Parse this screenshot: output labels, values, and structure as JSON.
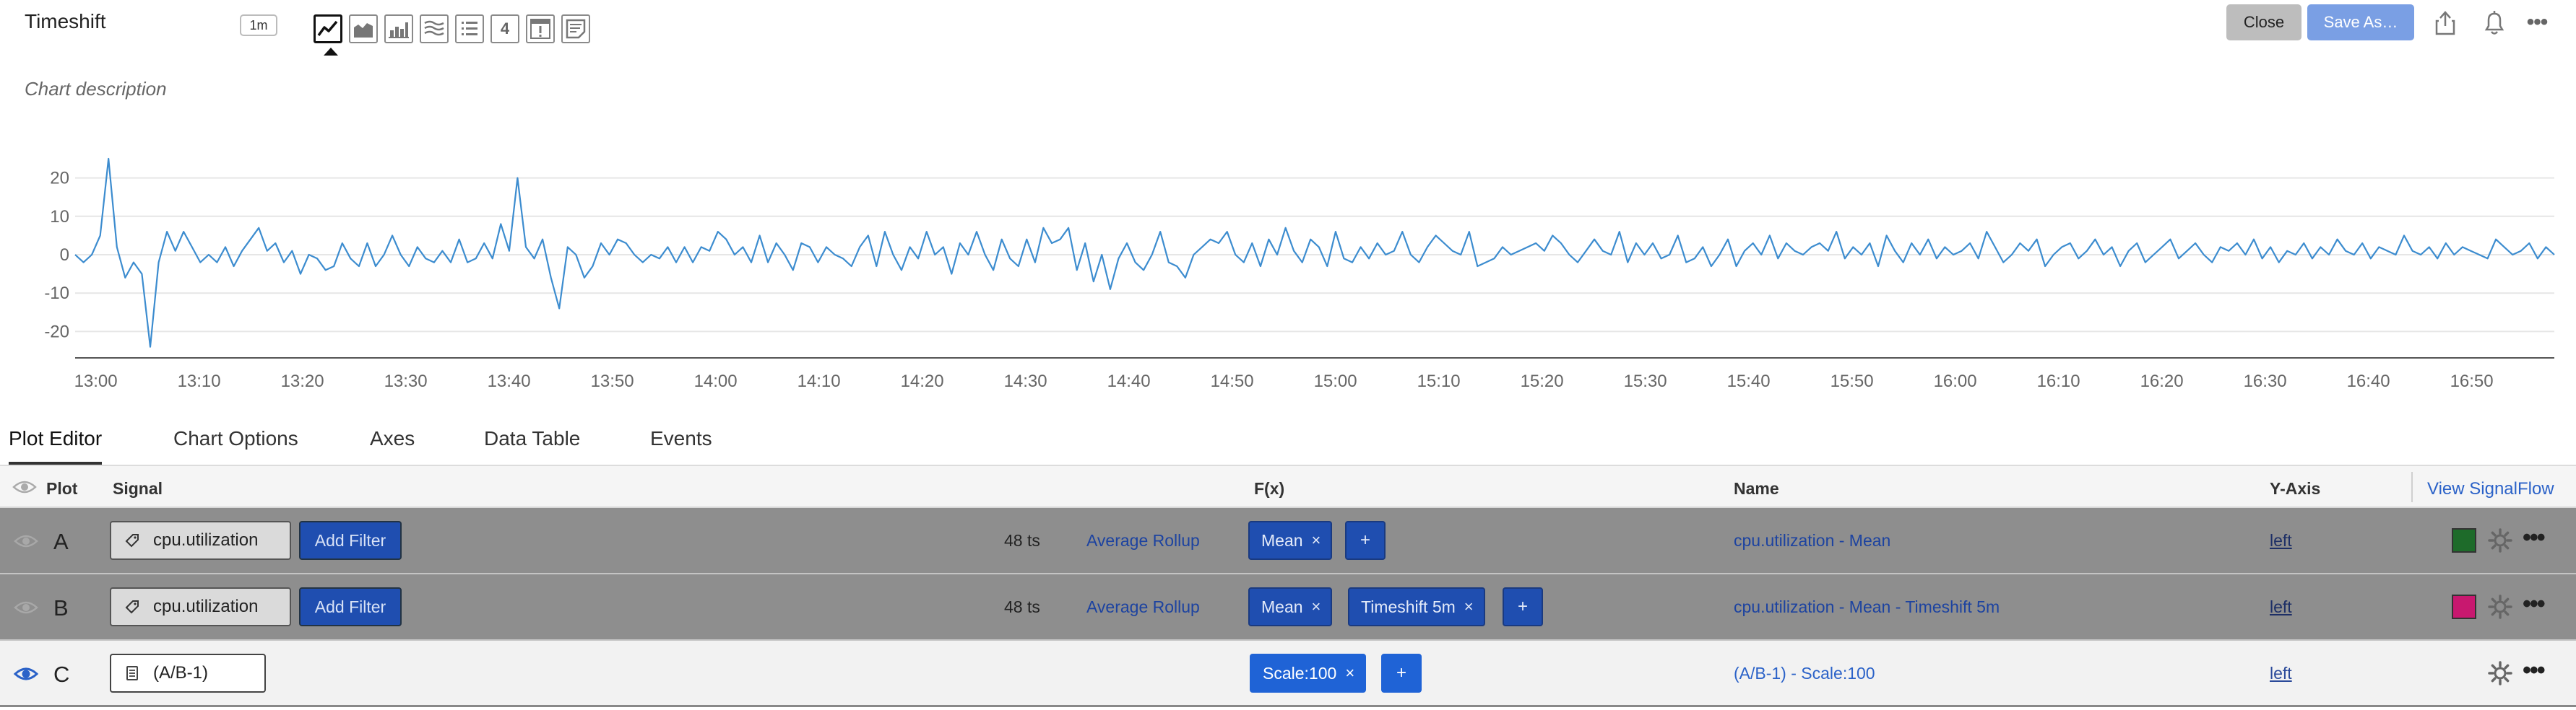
{
  "header": {
    "title": "Timeshift",
    "resolution": "1m",
    "chart_types": [
      {
        "icon": "line-chart-icon",
        "active": true
      },
      {
        "icon": "area-chart-icon",
        "active": false
      },
      {
        "icon": "column-chart-icon",
        "active": false
      },
      {
        "icon": "histogram-icon",
        "active": false
      },
      {
        "icon": "list-chart-icon",
        "active": false
      },
      {
        "icon": "single-value-icon",
        "label": "4",
        "active": false
      },
      {
        "icon": "event-feed-icon",
        "active": false
      },
      {
        "icon": "text-note-icon",
        "active": false
      }
    ],
    "description": "Chart description",
    "close_label": "Close",
    "save_label": "Save As…",
    "colors": {
      "save": "#7a9fe4",
      "close": "#bdbdbd"
    }
  },
  "chart_data": {
    "type": "line",
    "title": "",
    "xlabel": "",
    "ylabel": "",
    "ylim": [
      -25,
      25
    ],
    "y_ticks": [
      20,
      10,
      0,
      -10,
      -20
    ],
    "x_ticks": [
      "13:00",
      "13:10",
      "13:20",
      "13:30",
      "13:40",
      "13:50",
      "14:00",
      "14:10",
      "14:20",
      "14:30",
      "14:40",
      "14:50",
      "15:00",
      "15:10",
      "15:20",
      "15:30",
      "15:40",
      "15:50",
      "16:00",
      "16:10",
      "16:20",
      "16:30",
      "16:40",
      "16:50"
    ],
    "x_start": "12:58",
    "x_end": "16:58",
    "line_color": "#3c8ccf",
    "grid": true,
    "series": [
      {
        "values": [
          0,
          -2,
          0,
          5,
          25,
          2,
          -6,
          -2,
          -5,
          -24,
          -2,
          6,
          1,
          6,
          2,
          -2,
          0,
          -2,
          2,
          -3,
          1,
          4,
          7,
          1,
          3,
          -2,
          1,
          -5,
          0,
          -1,
          -4,
          -3,
          3,
          -1,
          -3,
          3,
          -3,
          0,
          5,
          0,
          -3,
          2,
          -1,
          -2,
          1,
          -2,
          4,
          -2,
          -1,
          3,
          -1,
          8,
          1,
          20,
          2,
          -1,
          4,
          -6,
          -14,
          2,
          0,
          -6,
          -3,
          3,
          0,
          4,
          3,
          0,
          -2,
          0,
          -1,
          2,
          -2,
          2,
          -2,
          2,
          1,
          6,
          4,
          0,
          2,
          -2,
          5,
          -2,
          3,
          0,
          -4,
          3,
          2,
          -2,
          2,
          0,
          -1,
          -3,
          2,
          5,
          -3,
          6,
          0,
          -4,
          2,
          -1,
          6,
          0,
          2,
          -5,
          3,
          0,
          6,
          0,
          -4,
          4,
          -1,
          -3,
          4,
          -2,
          7,
          3,
          4,
          7,
          -4,
          3,
          -7,
          0,
          -9,
          -1,
          3,
          -2,
          -4,
          0,
          6,
          -2,
          -3,
          -6,
          0,
          2,
          4,
          3,
          6,
          0,
          -2,
          3,
          -3,
          4,
          0,
          7,
          1,
          -2,
          4,
          2,
          -3,
          6,
          -1,
          -2,
          2,
          -1,
          3,
          0,
          1,
          6,
          0,
          -2,
          2,
          5,
          3,
          1,
          0,
          6,
          -3,
          -2,
          -1,
          2,
          0,
          1,
          2,
          3,
          1,
          5,
          3,
          0,
          -2,
          1,
          4,
          1,
          0,
          6,
          -2,
          3,
          0,
          3,
          -1,
          0,
          5,
          -2,
          -1,
          2,
          -3,
          0,
          4,
          -3,
          1,
          3,
          0,
          5,
          -1,
          3,
          1,
          0,
          2,
          3,
          1,
          6,
          -1,
          2,
          0,
          3,
          -3,
          5,
          1,
          -2,
          3,
          0,
          4,
          -1,
          2,
          0,
          1,
          3,
          -1,
          6,
          2,
          -2,
          0,
          3,
          1,
          4,
          -3,
          0,
          2,
          3,
          -1,
          1,
          4,
          0,
          2,
          -3,
          1,
          3,
          -2,
          0,
          2,
          4,
          -1,
          1,
          3,
          0,
          -2,
          2,
          1,
          3,
          0,
          4,
          -1,
          2,
          -2,
          1,
          0,
          3,
          -1,
          2,
          0,
          4,
          1,
          0,
          3,
          -1,
          2,
          1,
          0,
          5,
          1,
          0,
          2,
          -1,
          3,
          0,
          2,
          1,
          0,
          -1,
          4,
          2,
          0,
          1,
          3,
          -1,
          2,
          0
        ]
      }
    ]
  },
  "tabs": [
    {
      "label": "Plot Editor",
      "active": true
    },
    {
      "label": "Chart Options",
      "active": false
    },
    {
      "label": "Axes",
      "active": false
    },
    {
      "label": "Data Table",
      "active": false
    },
    {
      "label": "Events",
      "active": false
    }
  ],
  "table": {
    "headers": {
      "plot": "Plot",
      "signal": "Signal",
      "fx": "F(x)",
      "name": "Name",
      "yaxis": "Y-Axis",
      "view_signalflow": "View SignalFlow"
    },
    "rows": [
      {
        "letter": "A",
        "visible": false,
        "signal": "cpu.utilization",
        "signal_icon": "metric-tag-icon",
        "filter_label": "Add Filter",
        "ts_count": "48 ts",
        "rollup": "Average Rollup",
        "functions": [
          "Mean"
        ],
        "name": "cpu.utilization - Mean",
        "yaxis": "left",
        "color": "#1e6b2a"
      },
      {
        "letter": "B",
        "visible": false,
        "signal": "cpu.utilization",
        "signal_icon": "metric-tag-icon",
        "filter_label": "Add Filter",
        "ts_count": "48 ts",
        "rollup": "Average Rollup",
        "functions": [
          "Mean",
          "Timeshift 5m"
        ],
        "name": "cpu.utilization - Mean - Timeshift 5m",
        "yaxis": "left",
        "color": "#c8186f"
      },
      {
        "letter": "C",
        "visible": true,
        "signal": "(A/B-1)",
        "signal_icon": "formula-icon",
        "functions": [
          "Scale:100"
        ],
        "name": "(A/B-1) - Scale:100",
        "yaxis": "left"
      }
    ],
    "add_symbol": "+",
    "remove_symbol": "×",
    "more_symbol": "•••"
  }
}
